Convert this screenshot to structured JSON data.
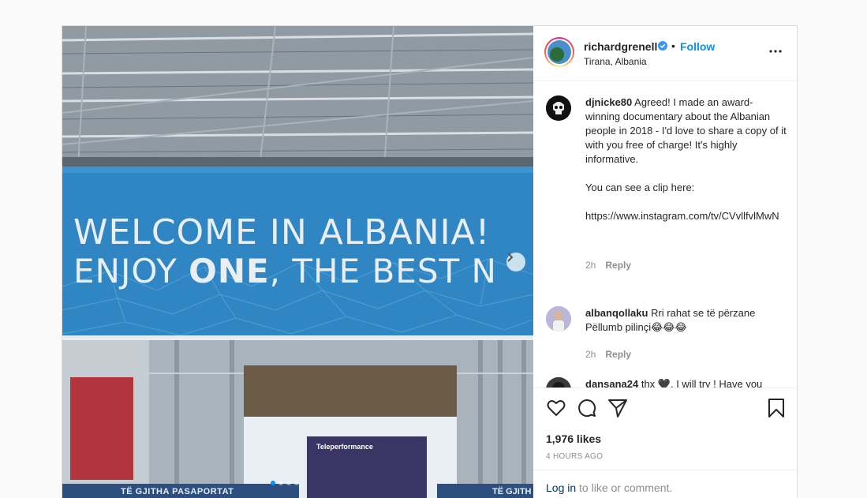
{
  "post": {
    "image": {
      "sign_line1": "WELCOME IN ALBANIA!",
      "sign_line2_pre": "ENJOY ",
      "sign_line2_bold": "ONE",
      "sign_line2_post": ", THE BEST N",
      "teleperformance": "Teleperformance",
      "passport_text": "TË GJITHA PASAPORTAT",
      "passport_text2": "TË GJITH",
      "carousel_count": 4,
      "carousel_active": 1
    },
    "header": {
      "username": "richardgrenell",
      "bullet": "•",
      "follow_label": "Follow",
      "location": "Tirana, Albania"
    },
    "comments": [
      {
        "username": "djnicke80",
        "text": "Agreed! I made an award-winning documentary about the Albanian people in 2018 - I'd love to share a copy of it with you free of charge! It's highly informative.\n\nYou can see a clip here:\n\nhttps://www.instagram.com/tv/CVvllfvlMwN",
        "time": "2h",
        "reply_label": "Reply"
      },
      {
        "username": "albanqollaku",
        "text": "Rri rahat se të përzane Pëllumb pilinçi😂😂😂",
        "time": "2h",
        "reply_label": "Reply"
      },
      {
        "username": "dansana24",
        "text": "thx 🖤. I will try ! Have you been there?",
        "time": "",
        "reply_label": ""
      }
    ],
    "actions": {
      "likes": "1,976 likes",
      "time": "4 HOURS AGO",
      "login_link": "Log in",
      "login_rest": " to like or comment."
    },
    "icons": [
      "heart-icon",
      "comment-icon",
      "share-icon",
      "bookmark-icon",
      "more-icon",
      "verified-icon",
      "chevron-right-icon"
    ],
    "colors": {
      "link": "#0095f6",
      "login": "#00376b",
      "muted": "#8e8e8e",
      "sign_blue": "#2f86c3"
    }
  }
}
